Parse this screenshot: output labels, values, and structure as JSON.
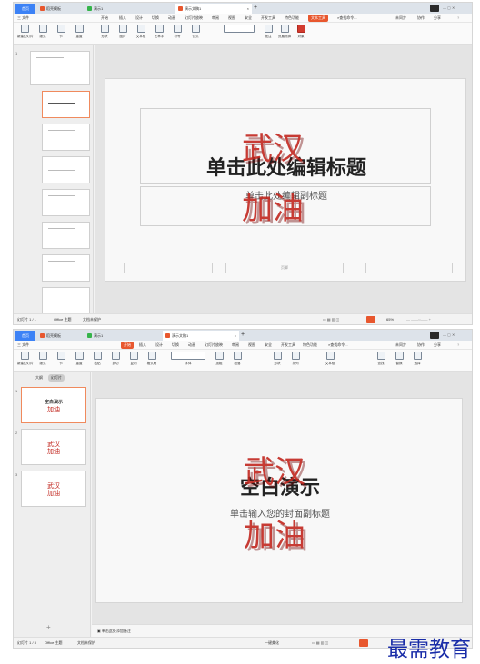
{
  "window1": {
    "tabs": {
      "home": "首页",
      "app": "稻壳模板",
      "doc": "演示1",
      "file": "演示文稿1"
    },
    "menu": [
      "三 文件",
      "开始",
      "插入",
      "设计",
      "切换",
      "动画",
      "幻灯片放映",
      "审阅",
      "视图",
      "安全",
      "开发工具",
      "特色功能",
      "文本工具",
      "查找命令..."
    ],
    "menu_active": "文本工具",
    "right_actions": [
      "未同步",
      "协作",
      "分享"
    ],
    "toolbar": [
      "新建幻灯片",
      "版式",
      "节",
      "重置",
      "形状",
      "图片",
      "文本框",
      "艺术字",
      "符号",
      "公式",
      "批注",
      "页眉页脚",
      "编号",
      "对象"
    ],
    "slide": {
      "title": "单击此处编辑标题",
      "subtitle": "单击此处编辑副标题",
      "footer_center": "页脚",
      "watermark": [
        "武汉",
        "加油"
      ]
    },
    "status": {
      "left": "幻灯片 1 / 1",
      "theme": "Office 主题",
      "protect": "文档未保护",
      "zoom": "65%"
    }
  },
  "window2": {
    "tabs": {
      "home": "首页",
      "app": "稻壳模板",
      "doc": "演示1",
      "file": "演示文稿1"
    },
    "menu": [
      "三 文件",
      "开始",
      "插入",
      "设计",
      "切换",
      "动画",
      "幻灯片放映",
      "审阅",
      "视图",
      "安全",
      "开发工具",
      "特色功能",
      "文本工具",
      "查找命令..."
    ],
    "menu_active": "开始",
    "right_actions": [
      "未同步",
      "协作",
      "分享"
    ],
    "toolbar": [
      "新建幻灯片",
      "版式",
      "节",
      "重置",
      "粘贴",
      "剪切",
      "复制",
      "格式刷",
      "字体",
      "加粗",
      "段落",
      "形状",
      "排列",
      "文本框",
      "查找",
      "替换",
      "选择"
    ],
    "panel_tabs": [
      "大纲",
      "幻灯片"
    ],
    "slide": {
      "title": "空白演示",
      "subtitle": "单击输入您的封面副标题",
      "watermark": [
        "武汉",
        "加油"
      ]
    },
    "thumb_wm": [
      "武汉",
      "加油"
    ],
    "thumb1_title": "空白演示",
    "notes": "单击此处添加备注",
    "status": {
      "left": "幻灯片 1 / 3",
      "theme": "Office 主题",
      "protect": "文档未保护",
      "mode": "一键美化",
      "zoom": "64%"
    }
  },
  "brand": "最需教育"
}
